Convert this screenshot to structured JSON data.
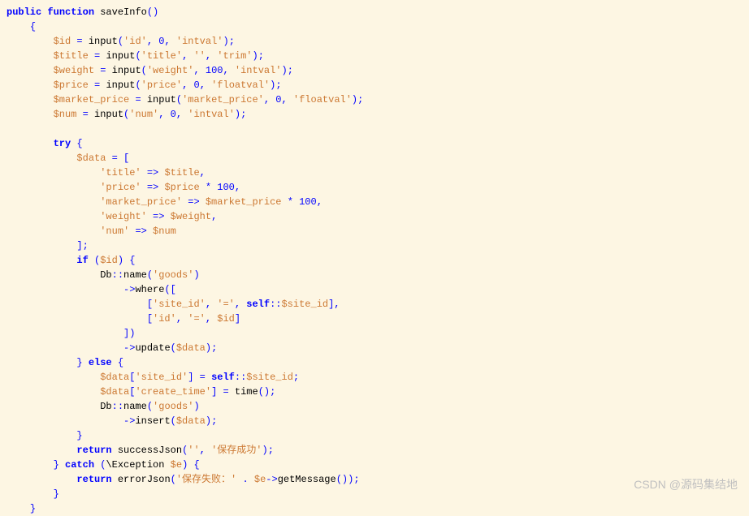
{
  "code": {
    "line01": {
      "kw1": "public",
      "kw2": "function",
      "fn": "saveInfo"
    },
    "line03": {
      "v": "$id",
      "fn": "input",
      "s": "'id'",
      "n": "0",
      "s2": "'intval'"
    },
    "line04": {
      "v": "$title",
      "fn": "input",
      "s": "'title'",
      "s2": "''",
      "s3": "'trim'"
    },
    "line05": {
      "v": "$weight",
      "fn": "input",
      "s": "'weight'",
      "n": "100",
      "s2": "'intval'"
    },
    "line06": {
      "v": "$price",
      "fn": "input",
      "s": "'price'",
      "n": "0",
      "s2": "'floatval'"
    },
    "line07": {
      "v": "$market_price",
      "fn": "input",
      "s": "'market_price'",
      "n": "0",
      "s2": "'floatval'"
    },
    "line08": {
      "v": "$num",
      "fn": "input",
      "s": "'num'",
      "n": "0",
      "s2": "'intval'"
    },
    "line10": {
      "kw": "try"
    },
    "line11": {
      "v": "$data"
    },
    "line12": {
      "s": "'title'",
      "v": "$title"
    },
    "line13": {
      "s": "'price'",
      "v": "$price",
      "n": "100"
    },
    "line14": {
      "s": "'market_price'",
      "v": "$market_price",
      "n": "100"
    },
    "line15": {
      "s": "'weight'",
      "v": "$weight"
    },
    "line16": {
      "s": "'num'",
      "v": "$num"
    },
    "line18": {
      "kw": "if",
      "v": "$id"
    },
    "line19": {
      "cls": "Db",
      "fn": "name",
      "s": "'goods'"
    },
    "line20": {
      "fn": "where"
    },
    "line21": {
      "s": "'site_id'",
      "s2": "'='",
      "kw": "self",
      "v": "$site_id"
    },
    "line22": {
      "s": "'id'",
      "s2": "'='",
      "v": "$id"
    },
    "line24": {
      "fn": "update",
      "v": "$data"
    },
    "line25": {
      "kw": "else"
    },
    "line26": {
      "v": "$data",
      "s": "'site_id'",
      "kw": "self",
      "v2": "$site_id"
    },
    "line27": {
      "v": "$data",
      "s": "'create_time'",
      "fn": "time"
    },
    "line28": {
      "cls": "Db",
      "fn": "name",
      "s": "'goods'"
    },
    "line29": {
      "fn": "insert",
      "v": "$data"
    },
    "line31": {
      "kw": "return",
      "fn": "successJson",
      "s": "''",
      "s2": "'保存成功'"
    },
    "line32": {
      "kw": "catch",
      "cls": "\\Exception",
      "v": "$e"
    },
    "line33": {
      "kw": "return",
      "fn": "errorJson",
      "s": "'保存失败：'",
      "v": "$e",
      "fn2": "getMessage"
    }
  },
  "watermark": "CSDN @源码集结地"
}
